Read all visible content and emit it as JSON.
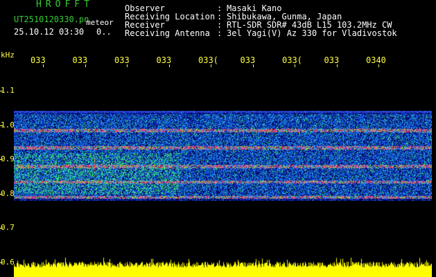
{
  "header": {
    "app_title": "HROFFT",
    "file_name": "UT2510120330.pn",
    "meteor_tag": "meteor",
    "date_time": "25.10.12 03:30",
    "count": "0..",
    "info": [
      {
        "label": "Observer",
        "value": "Masaki Kano"
      },
      {
        "label": "Receiving Location",
        "value": "Shibukawa, Gunma, Japan"
      },
      {
        "label": "Receiver",
        "value": "RTL-SDR SDR# 43dB L15 103.2MHz CW"
      },
      {
        "label": "Receiving Antenna",
        "value": "3el Yagi(V) Az 330 for Vladivostok"
      }
    ]
  },
  "axes": {
    "y_unit": "kHz",
    "x_ticks": [
      "033",
      "033",
      "033",
      "033",
      "033(",
      "033",
      "033(",
      "033",
      "0340"
    ],
    "y_ticks": [
      "1.1",
      "1.0",
      "0.9",
      "0.8",
      "0.7",
      "0.6"
    ]
  },
  "colors": {
    "background": "#000000",
    "header_green": "#33cc33",
    "header_white": "#ffffff",
    "axis_yellow": "#ffff44",
    "signal_band_blue": "#1a3cff",
    "carrier_red": "#ff3355",
    "noise_bars_yellow": "#ffff00"
  },
  "spectrogram": {
    "freq_range_khz": [
      0.6,
      1.15
    ],
    "noise_band_khz": [
      0.78,
      1.04
    ],
    "carrier_lines_khz": [
      0.985,
      0.935,
      0.88,
      0.835,
      0.79
    ],
    "meteor_echo": {
      "time_fraction": 0.28,
      "freq_khz": 0.88
    }
  }
}
